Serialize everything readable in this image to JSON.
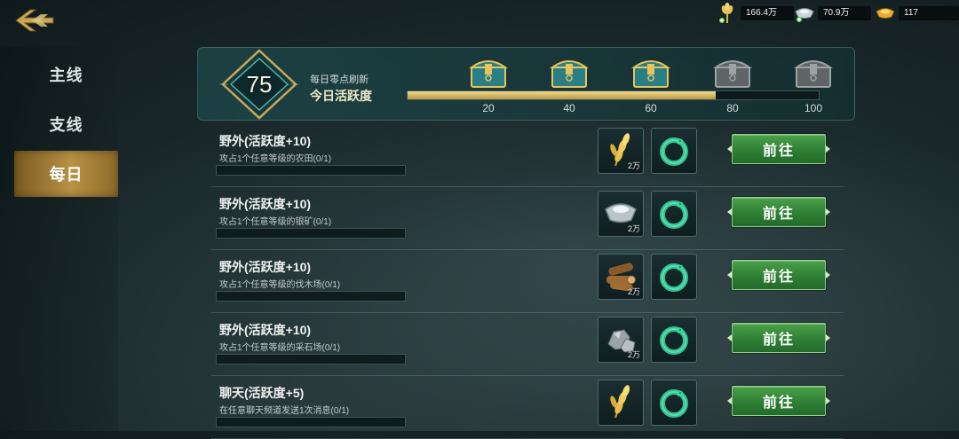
{
  "resources": {
    "food": {
      "value": "166.4万",
      "icon": "wheat-icon"
    },
    "silver": {
      "value": "70.9万",
      "icon": "silver-ingot-icon"
    },
    "gold": {
      "value": "117",
      "icon": "gold-ingot-icon"
    }
  },
  "sidebar": {
    "tabs": [
      {
        "label": "主线"
      },
      {
        "label": "支线"
      },
      {
        "label": "每日",
        "active": true
      }
    ]
  },
  "activity": {
    "points": "75",
    "subtitle": "每日零点刷新",
    "title": "今日活跃度",
    "progress": 0.75,
    "milestones": [
      {
        "value": "20",
        "claimed": true
      },
      {
        "value": "40",
        "claimed": true
      },
      {
        "value": "60",
        "claimed": true
      },
      {
        "value": "80",
        "claimed": false
      },
      {
        "value": "100",
        "claimed": false
      }
    ]
  },
  "tasks": [
    {
      "title": "野外(活跃度+10)",
      "desc": "攻占1个任意等级的农田(0/1)",
      "progress": 0,
      "reward1": {
        "icon": "wheat-icon",
        "qty": "2万"
      },
      "reward2": {
        "icon": "jade-dragon-icon"
      },
      "button": "前往"
    },
    {
      "title": "野外(活跃度+10)",
      "desc": "攻占1个任意等级的银矿(0/1)",
      "progress": 0,
      "reward1": {
        "icon": "silver-ingot-icon",
        "qty": "2万"
      },
      "reward2": {
        "icon": "jade-dragon-icon"
      },
      "button": "前往"
    },
    {
      "title": "野外(活跃度+10)",
      "desc": "攻占1个任意等级的伐木场(0/1)",
      "progress": 0,
      "reward1": {
        "icon": "wood-logs-icon",
        "qty": "2万"
      },
      "reward2": {
        "icon": "jade-dragon-icon"
      },
      "button": "前往"
    },
    {
      "title": "野外(活跃度+10)",
      "desc": "攻占1个任意等级的采石场(0/1)",
      "progress": 0,
      "reward1": {
        "icon": "stone-icon",
        "qty": "2万"
      },
      "reward2": {
        "icon": "jade-dragon-icon"
      },
      "button": "前往"
    },
    {
      "title": "聊天(活跃度+5)",
      "desc": "在任意聊天频道发送1次消息(0/1)",
      "progress": 0,
      "reward1": {
        "icon": "wheat-icon",
        "qty": ""
      },
      "reward2": {
        "icon": "jade-dragon-icon"
      },
      "button": "前往"
    }
  ]
}
